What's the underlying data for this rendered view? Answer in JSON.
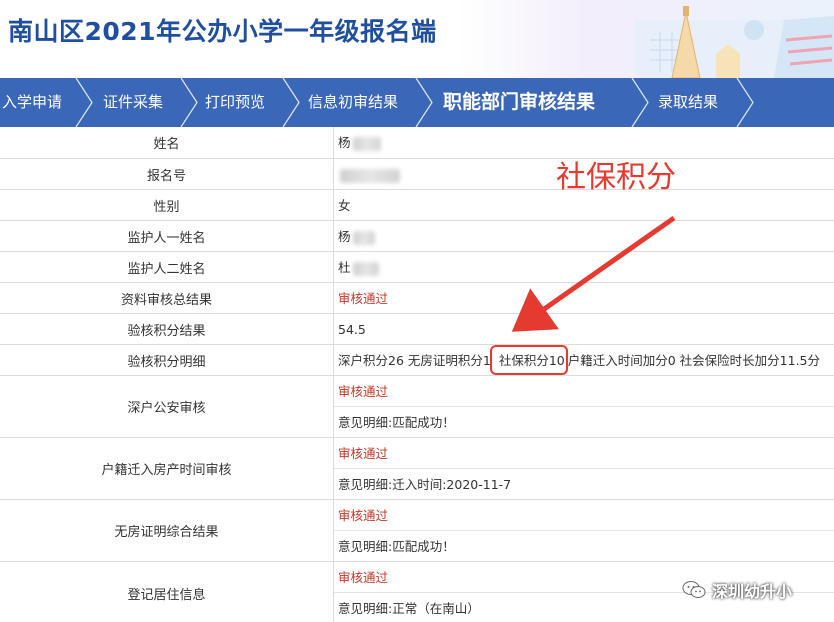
{
  "header": {
    "title": "南山区2021年公办小学一年级报名端"
  },
  "steps": [
    {
      "label": "入学申请",
      "active": false
    },
    {
      "label": "证件采集",
      "active": false
    },
    {
      "label": "打印预览",
      "active": false
    },
    {
      "label": "信息初审结果",
      "active": false
    },
    {
      "label": "职能部门审核结果",
      "active": true
    },
    {
      "label": "录取结果",
      "active": false
    }
  ],
  "rows": {
    "name": {
      "label": "姓名",
      "value": "杨"
    },
    "reg_no": {
      "label": "报名号",
      "value": ""
    },
    "gender": {
      "label": "性别",
      "value": "女"
    },
    "guardian1": {
      "label": "监护人一姓名",
      "value": "杨"
    },
    "guardian2": {
      "label": "监护人二姓名",
      "value": "杜"
    },
    "overall": {
      "label": "资料审核总结果",
      "value": "审核通过"
    },
    "score": {
      "label": "验核积分结果",
      "value": "54.5"
    },
    "detail": {
      "label": "验核积分明细",
      "part1": "深户积分26 无房证明积分1",
      "part2": "社保积分10",
      "part3": "户籍迁入时间加分0 社会保险时长加分11.5分"
    },
    "police": {
      "label": "深户公安审核",
      "status": "审核通过",
      "note": "意见明细:匹配成功！"
    },
    "hukou_time": {
      "label": "户籍迁入房产时间审核",
      "status": "审核通过",
      "note": "意见明细:迁入时间:2020-11-7"
    },
    "no_house": {
      "label": "无房证明综合结果",
      "status": "审核通过",
      "note": "意见明细:匹配成功！"
    },
    "residence": {
      "label": "登记居住信息",
      "status": "审核通过",
      "note": "意见明细:正常（在南山）"
    }
  },
  "annotation": {
    "text": "社保积分"
  },
  "watermark": {
    "text": "深圳幼升小",
    "icon": "wechat-icon"
  },
  "colors": {
    "nav": "#3a67b7",
    "title": "#1f4f9e",
    "pass": "#c0392b",
    "annotation": "#e53a2f"
  }
}
